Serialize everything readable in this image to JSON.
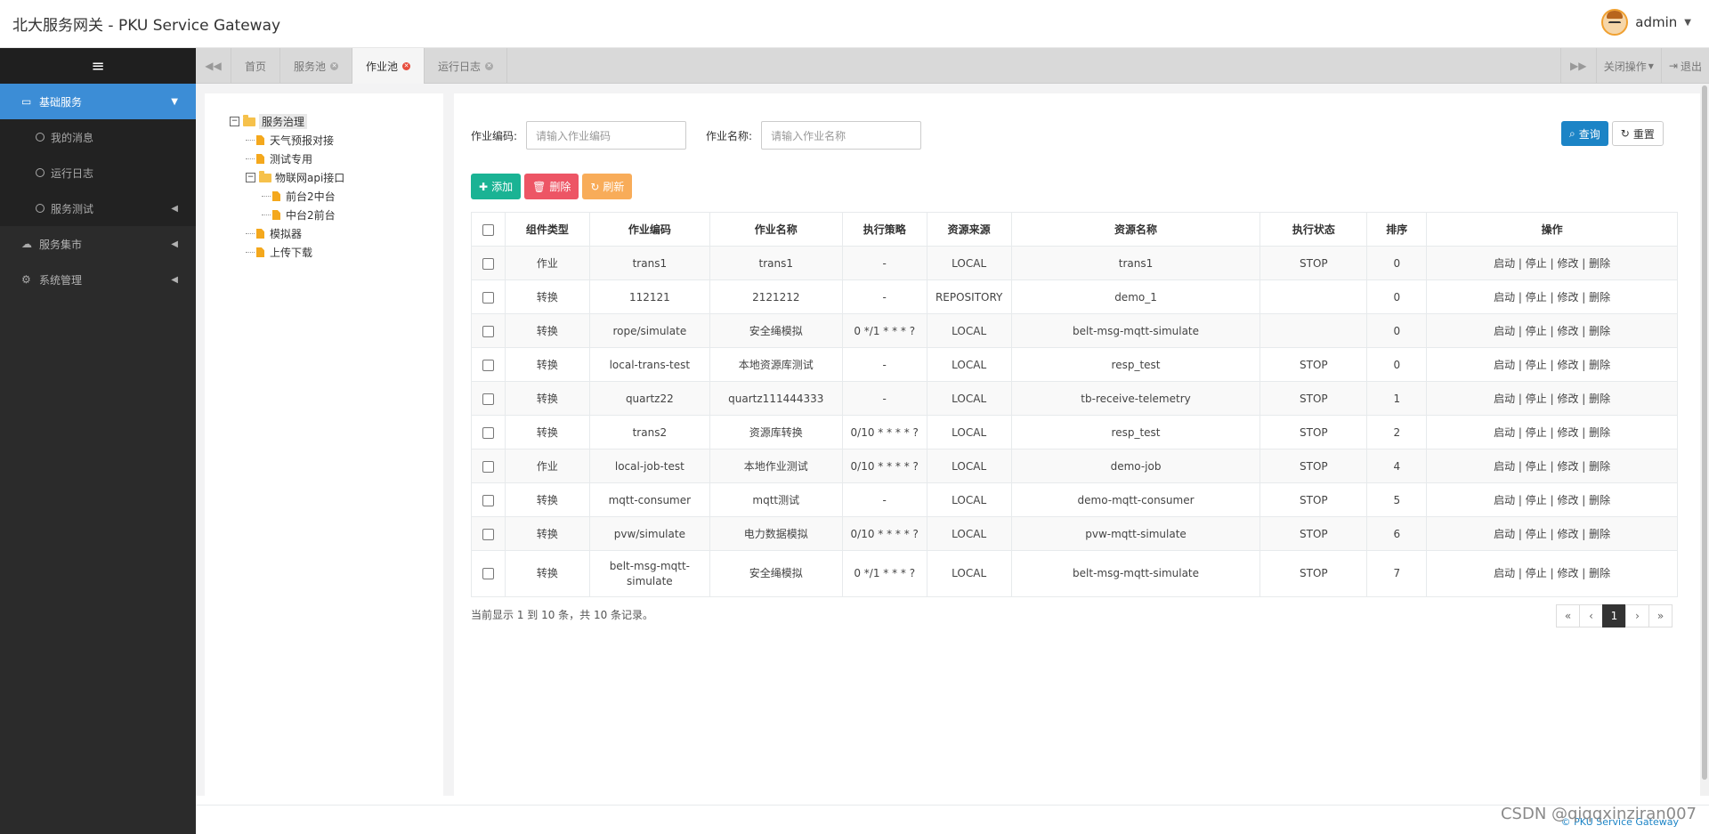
{
  "header": {
    "title": "北大服务网关 - PKU Service Gateway",
    "user": "admin"
  },
  "sidebar": {
    "toggle_icon": "hamburger-icon",
    "items": [
      {
        "label": "基础服务",
        "icon": "laptop-icon",
        "active": true
      },
      {
        "label": "我的消息"
      },
      {
        "label": "运行日志"
      },
      {
        "label": "服务测试"
      },
      {
        "label": "服务集市",
        "icon": "cloud-icon"
      },
      {
        "label": "系统管理",
        "icon": "gears-icon"
      }
    ]
  },
  "tabs": {
    "items": [
      "首页",
      "服务池",
      "作业池",
      "运行日志"
    ],
    "active": "作业池",
    "close_ops": "关闭操作",
    "logout": "退出"
  },
  "tree": {
    "root": "服务治理",
    "nodes": [
      "天气预报对接",
      "测试专用",
      "物联网api接口",
      "前台2中台",
      "中台2前台",
      "模拟器",
      "上传下载"
    ]
  },
  "search": {
    "code_label": "作业编码:",
    "code_placeholder": "请输入作业编码",
    "name_label": "作业名称:",
    "name_placeholder": "请输入作业名称",
    "query": "查询",
    "reset": "重置"
  },
  "toolbar": {
    "add": "添加",
    "delete": "删除",
    "refresh": "刷新"
  },
  "table": {
    "headers": [
      "组件类型",
      "作业编码",
      "作业名称",
      "执行策略",
      "资源来源",
      "资源名称",
      "执行状态",
      "排序",
      "操作"
    ],
    "rows": [
      [
        "作业",
        "trans1",
        "trans1",
        "-",
        "LOCAL",
        "trans1",
        "STOP",
        "0"
      ],
      [
        "转换",
        "112121",
        "2121212",
        "-",
        "REPOSITORY",
        "demo_1",
        "",
        "0"
      ],
      [
        "转换",
        "rope/simulate",
        "安全绳模拟",
        "0 */1 * * * ?",
        "LOCAL",
        "belt-msg-mqtt-simulate",
        "",
        "0"
      ],
      [
        "转换",
        "local-trans-test",
        "本地资源库测试",
        "-",
        "LOCAL",
        "resp_test",
        "STOP",
        "0"
      ],
      [
        "转换",
        "quartz22",
        "quartz111444333",
        "-",
        "LOCAL",
        "tb-receive-telemetry",
        "STOP",
        "1"
      ],
      [
        "转换",
        "trans2",
        "资源库转换",
        "0/10 * * * * ?",
        "LOCAL",
        "resp_test",
        "STOP",
        "2"
      ],
      [
        "作业",
        "local-job-test",
        "本地作业测试",
        "0/10 * * * * ?",
        "LOCAL",
        "demo-job",
        "STOP",
        "4"
      ],
      [
        "转换",
        "mqtt-consumer",
        "mqtt测试",
        "-",
        "LOCAL",
        "demo-mqtt-consumer",
        "STOP",
        "5"
      ],
      [
        "转换",
        "pvw/simulate",
        "电力数据模拟",
        "0/10 * * * * ?",
        "LOCAL",
        "pvw-mqtt-simulate",
        "STOP",
        "6"
      ],
      [
        "转换",
        "belt-msg-mqtt-simulate",
        "安全绳模拟",
        "0 */1 * * * ?",
        "LOCAL",
        "belt-msg-mqtt-simulate",
        "STOP",
        "7"
      ]
    ],
    "ops": [
      "启动",
      "停止",
      "修改",
      "删除"
    ]
  },
  "pager": {
    "info": "当前显示 1 到 10 条，共 10 条记录。",
    "first": "«",
    "prev": "‹",
    "current": "1",
    "next": "›",
    "last": "»"
  },
  "footer": {
    "text": "© PKU Service Gateway",
    "watermark": "CSDN @qiqqxinziran007"
  }
}
